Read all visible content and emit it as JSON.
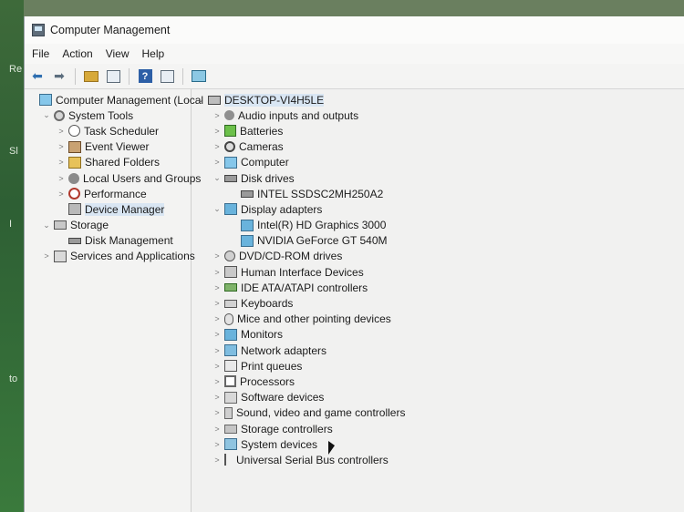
{
  "desktop": {
    "glyphs": [
      "Re",
      "Sl",
      "I",
      "to"
    ]
  },
  "window": {
    "title": "Computer Management"
  },
  "menu": [
    "File",
    "Action",
    "View",
    "Help"
  ],
  "toolbar": {
    "icons": [
      "back-arrow-icon",
      "forward-arrow-icon",
      "up-folder-icon",
      "show-hide-tree-icon",
      "help-icon",
      "properties-icon",
      "scan-hardware-icon"
    ]
  },
  "left_tree": [
    {
      "label": "Computer Management (Local",
      "level": 0,
      "expander": "",
      "icon": "computer-management-icon"
    },
    {
      "label": "System Tools",
      "level": 1,
      "expander": "⌄",
      "icon": "tools-icon"
    },
    {
      "label": "Task Scheduler",
      "level": 2,
      "expander": ">",
      "icon": "clock-icon"
    },
    {
      "label": "Event Viewer",
      "level": 2,
      "expander": ">",
      "icon": "event-log-icon"
    },
    {
      "label": "Shared Folders",
      "level": 2,
      "expander": ">",
      "icon": "folder-icon"
    },
    {
      "label": "Local Users and Groups",
      "level": 2,
      "expander": ">",
      "icon": "users-icon"
    },
    {
      "label": "Performance",
      "level": 2,
      "expander": ">",
      "icon": "performance-icon"
    },
    {
      "label": "Device Manager",
      "level": 2,
      "expander": "",
      "icon": "device-manager-icon",
      "selected": true
    },
    {
      "label": "Storage",
      "level": 1,
      "expander": "⌄",
      "icon": "storage-icon"
    },
    {
      "label": "Disk Management",
      "level": 2,
      "expander": "",
      "icon": "disk-icon"
    },
    {
      "label": "Services and Applications",
      "level": 1,
      "expander": ">",
      "icon": "services-icon"
    }
  ],
  "right_tree": [
    {
      "label": "DESKTOP-VI4H5LE",
      "level": 0,
      "expander": "⌄",
      "icon": "host-icon",
      "selected": true
    },
    {
      "label": "Audio inputs and outputs",
      "level": 1,
      "expander": ">",
      "icon": "audio-icon"
    },
    {
      "label": "Batteries",
      "level": 1,
      "expander": ">",
      "icon": "battery-icon"
    },
    {
      "label": "Cameras",
      "level": 1,
      "expander": ">",
      "icon": "camera-icon"
    },
    {
      "label": "Computer",
      "level": 1,
      "expander": ">",
      "icon": "computer-icon"
    },
    {
      "label": "Disk drives",
      "level": 1,
      "expander": "⌄",
      "icon": "disk-drive-icon"
    },
    {
      "label": "INTEL SSDSC2MH250A2",
      "level": 2,
      "expander": "",
      "icon": "drive-icon"
    },
    {
      "label": "Display adapters",
      "level": 1,
      "expander": "⌄",
      "icon": "display-adapter-icon"
    },
    {
      "label": "Intel(R) HD Graphics 3000",
      "level": 2,
      "expander": "",
      "icon": "display-adapter-icon"
    },
    {
      "label": "NVIDIA GeForce GT 540M",
      "level": 2,
      "expander": "",
      "icon": "display-adapter-icon"
    },
    {
      "label": "DVD/CD-ROM drives",
      "level": 1,
      "expander": ">",
      "icon": "dvd-icon"
    },
    {
      "label": "Human Interface Devices",
      "level": 1,
      "expander": ">",
      "icon": "hid-icon"
    },
    {
      "label": "IDE ATA/ATAPI controllers",
      "level": 1,
      "expander": ">",
      "icon": "ide-controller-icon"
    },
    {
      "label": "Keyboards",
      "level": 1,
      "expander": ">",
      "icon": "keyboard-icon"
    },
    {
      "label": "Mice and other pointing devices",
      "level": 1,
      "expander": ">",
      "icon": "mouse-icon"
    },
    {
      "label": "Monitors",
      "level": 1,
      "expander": ">",
      "icon": "monitor-icon"
    },
    {
      "label": "Network adapters",
      "level": 1,
      "expander": ">",
      "icon": "network-adapter-icon"
    },
    {
      "label": "Print queues",
      "level": 1,
      "expander": ">",
      "icon": "print-queue-icon"
    },
    {
      "label": "Processors",
      "level": 1,
      "expander": ">",
      "icon": "processor-icon"
    },
    {
      "label": "Software devices",
      "level": 1,
      "expander": ">",
      "icon": "software-device-icon"
    },
    {
      "label": "Sound, video and game controllers",
      "level": 1,
      "expander": ">",
      "icon": "sound-icon"
    },
    {
      "label": "Storage controllers",
      "level": 1,
      "expander": ">",
      "icon": "storage-controller-icon"
    },
    {
      "label": "System devices",
      "level": 1,
      "expander": ">",
      "icon": "system-device-icon"
    },
    {
      "label": "Universal Serial Bus controllers",
      "level": 1,
      "expander": ">",
      "icon": "usb-icon"
    }
  ]
}
